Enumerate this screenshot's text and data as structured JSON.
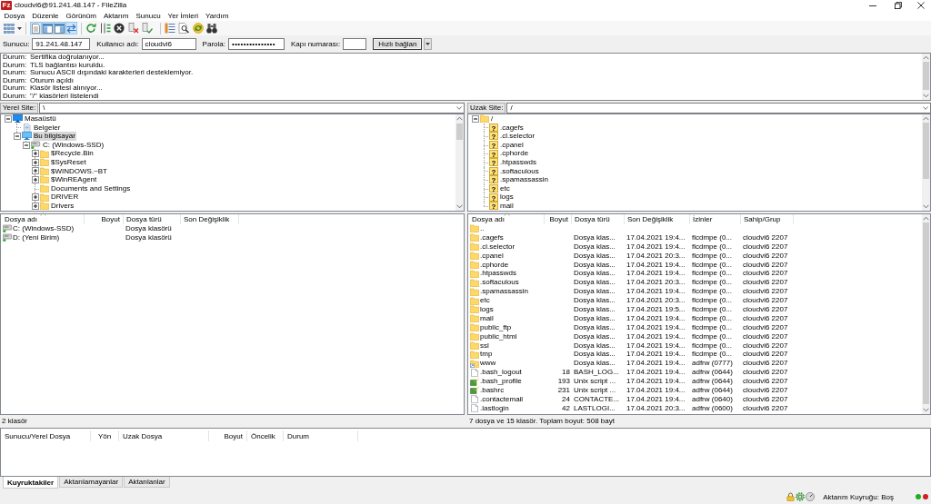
{
  "window": {
    "logo": "Fz",
    "title": "cloudvi6@91.241.48.147 - FileZilla"
  },
  "menu": [
    "Dosya",
    "Düzenle",
    "Görünüm",
    "Aktarım",
    "Sunucu",
    "Yer İmleri",
    "Yardım"
  ],
  "toolbar": {
    "toggles": [
      {
        "on": true
      },
      {
        "on": true
      },
      {
        "on": true
      },
      {
        "on": true
      }
    ]
  },
  "quickconnect": {
    "fields": [
      {
        "kind": "text",
        "label": "Sunucu:",
        "value": "91.241.48.147"
      },
      {
        "kind": "text",
        "label": "Kullanıcı adı:",
        "value": "cloudvi6"
      },
      {
        "kind": "password",
        "label": "Parola:",
        "value": "•••••••••••••••"
      },
      {
        "kind": "text",
        "label": "Kapı numarası:"
      }
    ],
    "button": "Hızlı bağlan"
  },
  "log": [
    {
      "label": "Durum:",
      "text": "Sertifika doğrulanıyor..."
    },
    {
      "label": "Durum:",
      "text": "TLS bağlantısı kuruldu."
    },
    {
      "label": "Durum:",
      "text": "Sunucu ASCII dışındaki karakterleri desteklemiyor."
    },
    {
      "label": "Durum:",
      "text": "Oturum açıldı"
    },
    {
      "label": "Durum:",
      "text": "Klasör listesi alınıyor..."
    },
    {
      "label": "Durum:",
      "text": "\"/\" klasörleri listelendi"
    }
  ],
  "local": {
    "site_label": "Yerel Site:",
    "path": "\\",
    "tree": [
      {
        "label": "Masaüstü",
        "kind": "desktop",
        "expandable": true,
        "expanded": true,
        "selected": false,
        "children": [
          {
            "label": "Belgeler",
            "kind": "documents",
            "expandable": false,
            "selected": false
          },
          {
            "label": "Bu bilgisayar",
            "kind": "computer",
            "expandable": true,
            "expanded": true,
            "selected": true,
            "children": [
              {
                "label": "C: (Windows-SSD)",
                "kind": "drive",
                "expandable": true,
                "expanded": true,
                "selected": false,
                "children": [
                  {
                    "label": "$Recycle.Bin",
                    "kind": "folder",
                    "expandable": true,
                    "expanded": false,
                    "selected": false
                  },
                  {
                    "label": "$SysReset",
                    "kind": "folder",
                    "expandable": true,
                    "expanded": false,
                    "selected": false
                  },
                  {
                    "label": "$WINDOWS.~BT",
                    "kind": "folder",
                    "expandable": true,
                    "expanded": false,
                    "selected": false
                  },
                  {
                    "label": "$WinREAgent",
                    "kind": "folder",
                    "expandable": true,
                    "expanded": false,
                    "selected": false
                  },
                  {
                    "label": "Documents and Settings",
                    "kind": "folder",
                    "expandable": false,
                    "selected": false
                  },
                  {
                    "label": "DRIVER",
                    "kind": "folder",
                    "expandable": true,
                    "expanded": false,
                    "selected": false
                  },
                  {
                    "label": "Drivers",
                    "kind": "folder",
                    "expandable": true,
                    "expanded": false,
                    "selected": false
                  }
                ]
              }
            ]
          }
        ]
      }
    ],
    "list": {
      "columns": [
        "Dosya adı",
        "Boyut",
        "Dosya türü",
        "Son Değişiklik"
      ],
      "rows": [
        {
          "kind": "drive",
          "name": "C: (Windows-SSD)",
          "type": "Dosya klasörü"
        },
        {
          "kind": "drive",
          "name": "D: (Yeni Birim)",
          "type": "Dosya klasörü"
        }
      ]
    },
    "status": "2 klasör"
  },
  "remote": {
    "site_label": "Uzak Site:",
    "path": "/",
    "tree": [
      {
        "label": "/",
        "kind": "folder",
        "expandable": true,
        "expanded": true,
        "selected": false,
        "children": [
          {
            "label": ".cagefs",
            "kind": "unknown",
            "glyph": "?",
            "expandable": false,
            "selected": false
          },
          {
            "label": ".cl.selector",
            "kind": "unknown",
            "glyph": "?",
            "expandable": false,
            "selected": false
          },
          {
            "label": ".cpanel",
            "kind": "unknown",
            "glyph": "?",
            "expandable": false,
            "selected": false
          },
          {
            "label": ".cphorde",
            "kind": "unknown",
            "glyph": "?",
            "expandable": false,
            "selected": false
          },
          {
            "label": ".htpasswds",
            "kind": "unknown",
            "glyph": "?",
            "expandable": false,
            "selected": false
          },
          {
            "label": ".softaculous",
            "kind": "unknown",
            "glyph": "?",
            "expandable": false,
            "selected": false
          },
          {
            "label": ".spamassassin",
            "kind": "unknown",
            "glyph": "?",
            "expandable": false,
            "selected": false
          },
          {
            "label": "etc",
            "kind": "unknown",
            "glyph": "?",
            "expandable": false,
            "selected": false
          },
          {
            "label": "logs",
            "kind": "unknown",
            "glyph": "?",
            "expandable": false,
            "selected": false
          },
          {
            "label": "mail",
            "kind": "unknown",
            "glyph": "?",
            "expandable": false,
            "selected": false
          }
        ]
      }
    ],
    "list": {
      "columns": [
        "Dosya adı",
        "Boyut",
        "Dosya türü",
        "Son Değişiklik",
        "İzinler",
        "Sahip/Grup"
      ],
      "rows": [
        {
          "kind": "folder",
          "name": ".."
        },
        {
          "kind": "folder",
          "name": ".cagefs",
          "type": "Dosya klas...",
          "modified": "17.04.2021 19:4...",
          "permissions": "flcdmpe (0...",
          "owner": "cloudvi6 2207"
        },
        {
          "kind": "folder",
          "name": ".cl.selector",
          "type": "Dosya klas...",
          "modified": "17.04.2021 19:4...",
          "permissions": "flcdmpe (0...",
          "owner": "cloudvi6 2207"
        },
        {
          "kind": "folder",
          "name": ".cpanel",
          "type": "Dosya klas...",
          "modified": "17.04.2021 20:3...",
          "permissions": "flcdmpe (0...",
          "owner": "cloudvi6 2207"
        },
        {
          "kind": "folder",
          "name": ".cphorde",
          "type": "Dosya klas...",
          "modified": "17.04.2021 19:4...",
          "permissions": "flcdmpe (0...",
          "owner": "cloudvi6 2207"
        },
        {
          "kind": "folder",
          "name": ".htpasswds",
          "type": "Dosya klas...",
          "modified": "17.04.2021 19:4...",
          "permissions": "flcdmpe (0...",
          "owner": "cloudvi6 2207"
        },
        {
          "kind": "folder",
          "name": ".softaculous",
          "type": "Dosya klas...",
          "modified": "17.04.2021 20:3...",
          "permissions": "flcdmpe (0...",
          "owner": "cloudvi6 2207"
        },
        {
          "kind": "folder",
          "name": ".spamassassin",
          "type": "Dosya klas...",
          "modified": "17.04.2021 19:4...",
          "permissions": "flcdmpe (0...",
          "owner": "cloudvi6 2207"
        },
        {
          "kind": "folder",
          "name": "etc",
          "type": "Dosya klas...",
          "modified": "17.04.2021 20:3...",
          "permissions": "flcdmpe (0...",
          "owner": "cloudvi6 2207"
        },
        {
          "kind": "folder",
          "name": "logs",
          "type": "Dosya klas...",
          "modified": "17.04.2021 19:5...",
          "permissions": "flcdmpe (0...",
          "owner": "cloudvi6 2207"
        },
        {
          "kind": "folder",
          "name": "mail",
          "type": "Dosya klas...",
          "modified": "17.04.2021 19:4...",
          "permissions": "flcdmpe (0...",
          "owner": "cloudvi6 2207"
        },
        {
          "kind": "folder",
          "name": "public_ftp",
          "type": "Dosya klas...",
          "modified": "17.04.2021 19:4...",
          "permissions": "flcdmpe (0...",
          "owner": "cloudvi6 2207"
        },
        {
          "kind": "folder",
          "name": "public_html",
          "type": "Dosya klas...",
          "modified": "17.04.2021 19:4...",
          "permissions": "flcdmpe (0...",
          "owner": "cloudvi6 2207"
        },
        {
          "kind": "folder",
          "name": "ssl",
          "type": "Dosya klas...",
          "modified": "17.04.2021 19:4...",
          "permissions": "flcdmpe (0...",
          "owner": "cloudvi6 2207"
        },
        {
          "kind": "folder",
          "name": "tmp",
          "type": "Dosya klas...",
          "modified": "17.04.2021 19:4...",
          "permissions": "flcdmpe (0...",
          "owner": "cloudvi6 2207"
        },
        {
          "kind": "folder_link",
          "name": "www",
          "type": "Dosya klas...",
          "modified": "17.04.2021 19:4...",
          "permissions": "adfrw (0777)",
          "owner": "cloudvi6 2207"
        },
        {
          "kind": "file",
          "name": ".bash_logout",
          "size": "18",
          "type": "BASH_LOG...",
          "modified": "17.04.2021 19:4...",
          "permissions": "adfrw (0644)",
          "owner": "cloudvi6 2207"
        },
        {
          "kind": "script",
          "name": ".bash_profile",
          "size": "193",
          "type": "Unix script ...",
          "modified": "17.04.2021 19:4...",
          "permissions": "adfrw (0644)",
          "owner": "cloudvi6 2207"
        },
        {
          "kind": "script",
          "name": ".bashrc",
          "size": "231",
          "type": "Unix script ...",
          "modified": "17.04.2021 19:4...",
          "permissions": "adfrw (0644)",
          "owner": "cloudvi6 2207"
        },
        {
          "kind": "file",
          "name": ".contactemail",
          "size": "24",
          "type": "CONTACTE...",
          "modified": "17.04.2021 19:4...",
          "permissions": "adfrw (0640)",
          "owner": "cloudvi6 2207"
        },
        {
          "kind": "file",
          "name": ".lastlogin",
          "size": "42",
          "type": "LASTLOGI...",
          "modified": "17.04.2021 20:3...",
          "permissions": "adfrw (0600)",
          "owner": "cloudvi6 2207"
        }
      ]
    },
    "status": "7 dosya ve 15 klasör. Toplam boyut: 508 bayt"
  },
  "queue": {
    "columns": [
      "Sunucu/Yerel Dosya",
      "Yön",
      "Uzak Dosya",
      "Boyut",
      "Öncelik",
      "Durum"
    ]
  },
  "tabs": [
    {
      "label": "Kuyruktakiler",
      "selected": true
    },
    {
      "label": "Aktarılamayanlar",
      "selected": false
    },
    {
      "label": "Aktarılanlar",
      "selected": false
    }
  ],
  "status_bar": {
    "queue": "Aktarım Kuyruğu: Boş",
    "leds": [
      {
        "color": "#1fae1f"
      },
      {
        "color": "#d11f1f"
      }
    ]
  }
}
